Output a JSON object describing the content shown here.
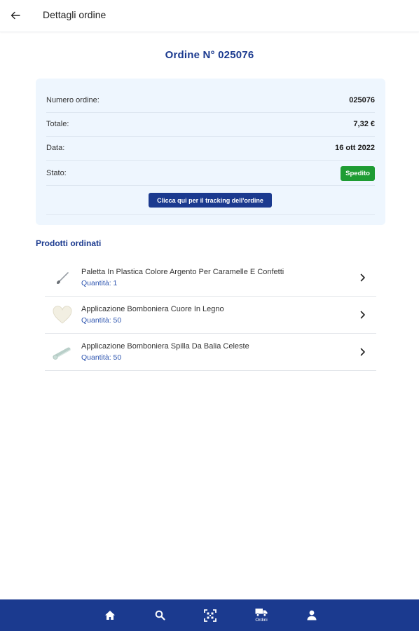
{
  "header": {
    "title": "Dettagli ordine",
    "back_icon": "arrow-left-icon"
  },
  "order": {
    "heading": "Ordine N° 025076",
    "rows": [
      {
        "label": "Numero ordine:",
        "value": "025076"
      },
      {
        "label": "Totale:",
        "value": "7,32 €"
      },
      {
        "label": "Data:",
        "value": "16 ott 2022"
      },
      {
        "label": "Stato:",
        "value": "Spedito"
      }
    ],
    "status_color": "#1e9c33",
    "tracking_button": "Clicca qui per il tracking dell'ordine"
  },
  "products": {
    "title": "Prodotti ordinati",
    "items": [
      {
        "name": "Paletta In Plastica Colore Argento Per Caramelle E Confetti",
        "qty": "Quantità: 1",
        "icon": "spoon-icon"
      },
      {
        "name": "Applicazione Bomboniera Cuore In Legno",
        "qty": "Quantità: 50",
        "icon": "heart-icon"
      },
      {
        "name": "Applicazione Bomboniera Spilla Da Balia Celeste",
        "qty": "Quantità: 50",
        "icon": "safety-pin-icon"
      }
    ]
  },
  "nav": {
    "items": [
      {
        "icon": "home-icon",
        "label": ""
      },
      {
        "icon": "search-icon",
        "label": ""
      },
      {
        "icon": "scan-icon",
        "label": ""
      },
      {
        "icon": "truck-icon",
        "label": "Ordini"
      },
      {
        "icon": "user-icon",
        "label": ""
      }
    ]
  },
  "colors": {
    "brand": "#1b3a8f",
    "card_bg": "#eef6fe"
  }
}
